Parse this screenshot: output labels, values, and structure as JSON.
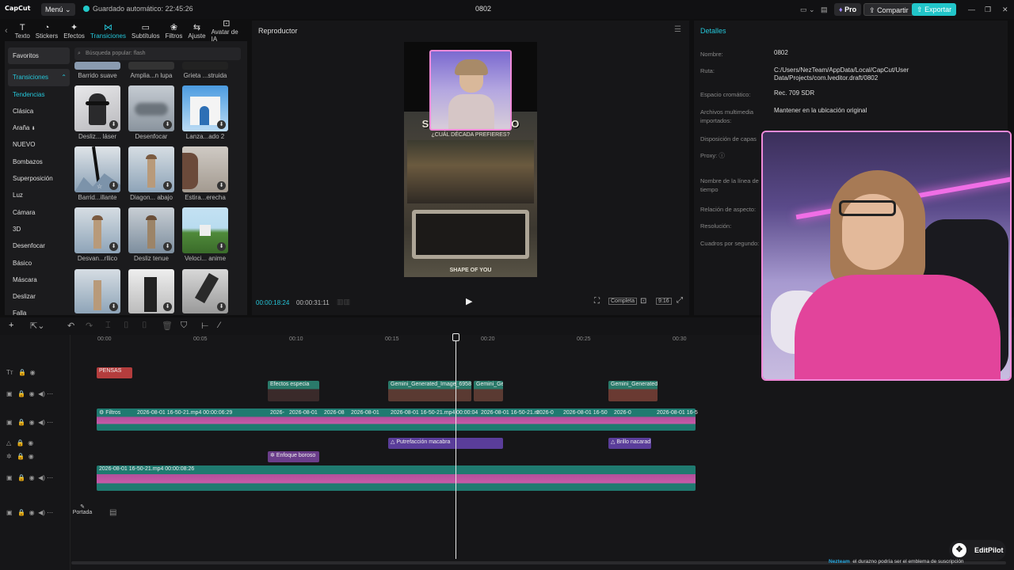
{
  "app": {
    "logo": "CapCut",
    "menu_label": "Menú",
    "autosave": "Guardado automático: 22:45:26",
    "project_title": "0802",
    "pro_label": "Pro",
    "share_label": "Compartir",
    "export_label": "Exportar"
  },
  "tools": [
    {
      "label": "Texto",
      "icon": "text-icon"
    },
    {
      "label": "Stickers",
      "icon": "sticker-icon"
    },
    {
      "label": "Efectos",
      "icon": "effects-icon"
    },
    {
      "label": "Transiciones",
      "icon": "transitions-icon"
    },
    {
      "label": "Subtítulos",
      "icon": "subtitles-icon"
    },
    {
      "label": "Filtros",
      "icon": "filters-icon"
    },
    {
      "label": "Ajuste",
      "icon": "adjust-icon"
    },
    {
      "label": "Avatar de IA",
      "icon": "avatar-icon"
    }
  ],
  "categories": {
    "favorites": "Favoritos",
    "transitions": "Transiciones",
    "items": [
      "Tendencias",
      "Clásica",
      "Araña",
      "NUEVO",
      "Bombazos",
      "Superposición",
      "Luz",
      "Cámara",
      "3D",
      "Desenfocar",
      "Básico",
      "Máscara",
      "Deslizar",
      "Falla"
    ]
  },
  "search": {
    "placeholder": "Búsqueda popular: flash"
  },
  "transitions": [
    {
      "label": "Barrido suave"
    },
    {
      "label": "Amplia...n lupa"
    },
    {
      "label": "Grieta ...struida"
    },
    {
      "label": "Desliz... láser"
    },
    {
      "label": "Desenfocar"
    },
    {
      "label": "Lanza...ado 2"
    },
    {
      "label": "Barrid...illante"
    },
    {
      "label": "Diagon... abajo"
    },
    {
      "label": "Estira...erecha"
    },
    {
      "label": "Desvan...rllico"
    },
    {
      "label": "Desliz tenue"
    },
    {
      "label": "Veloci... anime"
    },
    {
      "label": ""
    },
    {
      "label": ""
    },
    {
      "label": ""
    }
  ],
  "player": {
    "title": "Reproductor",
    "current_time": "00:00:18:24",
    "total_time": "00:00:31:11",
    "full_label": "Completa",
    "ratio_label": "9:16",
    "overlay_title": "SALÓN DE ESPEJO",
    "overlay_subtitle": "¿CUÁL DÉCADA PREFIERES?",
    "overlay_bottom": "SHAPE OF YOU"
  },
  "details": {
    "title": "Detalles",
    "rows": [
      {
        "key": "Nombre:",
        "value": "0802"
      },
      {
        "key": "Ruta:",
        "value": "C:/Users/NezTeam/AppData/Local/CapCut/User Data/Projects/com.lveditor.draft/0802"
      },
      {
        "key": "Espacio cromático:",
        "value": "Rec. 709 SDR"
      },
      {
        "key": "Archivos multimedia importados:",
        "value": "Mantener en la ubicación original"
      },
      {
        "key": "Disposición de capas",
        "value": ""
      },
      {
        "key": "Proxy:",
        "value": ""
      },
      {
        "key": "Nombre de la línea de tiempo",
        "value": ""
      },
      {
        "key": "Relación de aspecto:",
        "value": ""
      },
      {
        "key": "Resolución:",
        "value": ""
      },
      {
        "key": "Cuadros por segundo:",
        "value": ""
      }
    ]
  },
  "ruler": [
    "00:00",
    "00:05",
    "00:10",
    "00:15",
    "00:20",
    "00:25",
    "00:30"
  ],
  "clips": {
    "text_clip": "PENSAS",
    "effect1": "Efectos especia",
    "gemini1": "Gemini_Generated_Image_6958",
    "gemini2": "Gemini_Gen",
    "gemini3": "Gemini_Generated_",
    "main_filter": "Filtros",
    "main1": "2026-08-01 16-50-21.mp4  00:00:06:29",
    "main2": "2026-",
    "main3": "2026-08-01",
    "main4": "2026-08",
    "main5": "2026-08-01",
    "main6": "2026-08-01 16-50-21.mp4",
    "main7": "00:00:04",
    "main8": "2026-08-01 16-50-21.m",
    "main9": "2026-0",
    "main10": "2026-08-01 16-50",
    "main11": "2026-0",
    "main12": "2026-08-01 16-5",
    "fx1": "Putrefacción macabra",
    "fx2": "Brillo nacarad",
    "fx3": "Enfoque boroso",
    "lower1": "2026-08-01 16-50-21.mp4  00:00:08:26",
    "cover": "Portada"
  },
  "overlay": {
    "editpilot": "EditPilot",
    "ticker_name": "Nezteam",
    "ticker_text": "el durazno podría ser el emblema de suscripción"
  }
}
